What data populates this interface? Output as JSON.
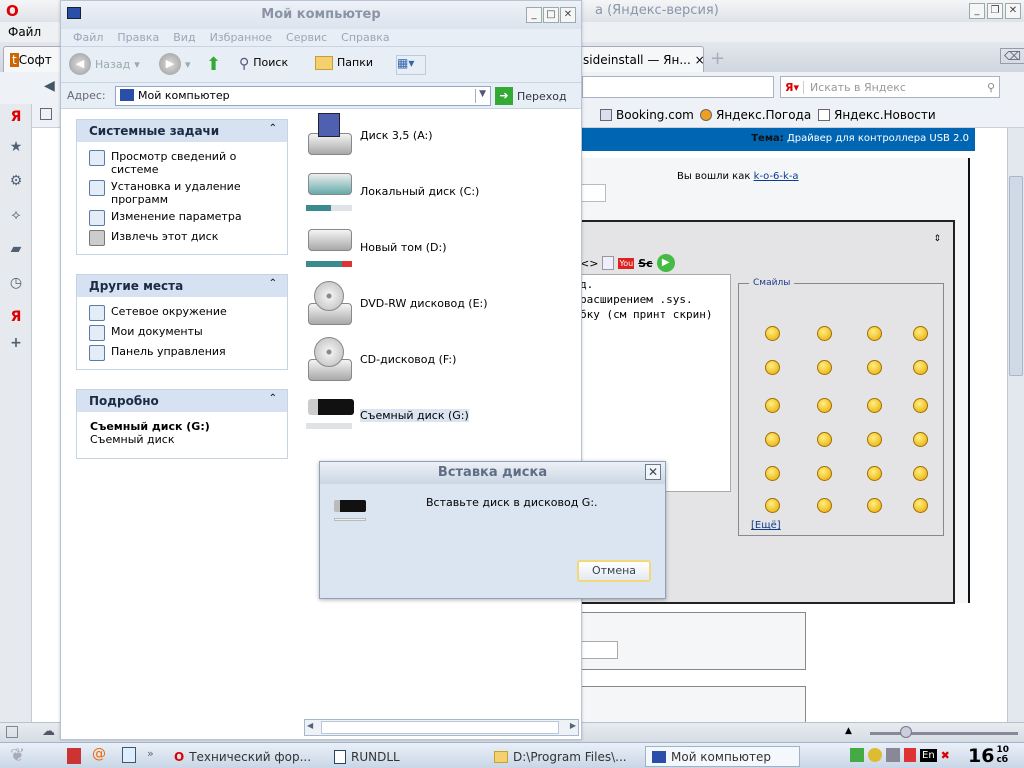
{
  "browser": {
    "title_fragment": "а (Яндекс-версия)",
    "menu": [
      "Файл"
    ],
    "tabs": [
      {
        "label": "Софт"
      },
      {
        "label": "sideinstall — Ян..."
      }
    ],
    "search_placeholder": "Искать в Яндекс",
    "bookmarks": [
      "Booking.com",
      "Яндекс.Погода",
      "Яндекс.Новости"
    ],
    "page": {
      "topic_label": "Тема:",
      "topic": "Драйвер для контроллера USB 2.0",
      "logged_in_as": "Вы вошли как",
      "username": "k-o-6-k-a",
      "editor_lines": [
        "д.",
        "расширением .sys.",
        "бку (см принт скрин)"
      ],
      "smileys_title": "Смайлы",
      "more_smileys": "[Ещё]"
    }
  },
  "explorer": {
    "title": "Мой компьютер",
    "menu": [
      "Файл",
      "Правка",
      "Вид",
      "Избранное",
      "Сервис",
      "Справка"
    ],
    "toolbar": {
      "back": "Назад",
      "search": "Поиск",
      "folders": "Папки"
    },
    "address_label": "Адрес:",
    "address_value": "Мой компьютер",
    "go": "Переход",
    "panels": [
      {
        "title": "Системные задачи",
        "items": [
          "Просмотр сведений о системе",
          "Установка и удаление программ",
          "Изменение параметра",
          "Извлечь этот диск"
        ]
      },
      {
        "title": "Другие места",
        "items": [
          "Сетевое окружение",
          "Мои документы",
          "Панель управления"
        ]
      },
      {
        "title": "Подробно",
        "detail_name": "Съемный диск (G:)",
        "detail_type": "Съемный диск"
      }
    ],
    "drives": [
      {
        "label": "Диск 3,5 (A:)",
        "type": "floppy"
      },
      {
        "label": "Локальный диск (C:)",
        "type": "hdd",
        "used": 0.55
      },
      {
        "label": "Новый том (D:)",
        "type": "hdd",
        "used": 0.78
      },
      {
        "label": "DVD-RW дисковод (E:)",
        "type": "cd"
      },
      {
        "label": "CD-дисковод (F:)",
        "type": "cd"
      },
      {
        "label": "Съемный диск (G:)",
        "type": "usb",
        "selected": true
      }
    ]
  },
  "dialog": {
    "title": "Вставка диска",
    "message": "Вставьте диск в дисковод G:.",
    "cancel": "Отмена"
  },
  "taskbar": {
    "items": [
      "Технический фор...",
      "RUNDLL",
      "D:\\Program Files\\...",
      "Мой компьютер"
    ],
    "clock_hour": "16",
    "clock_min": "10",
    "clock_day": "сб",
    "lang": "En"
  }
}
